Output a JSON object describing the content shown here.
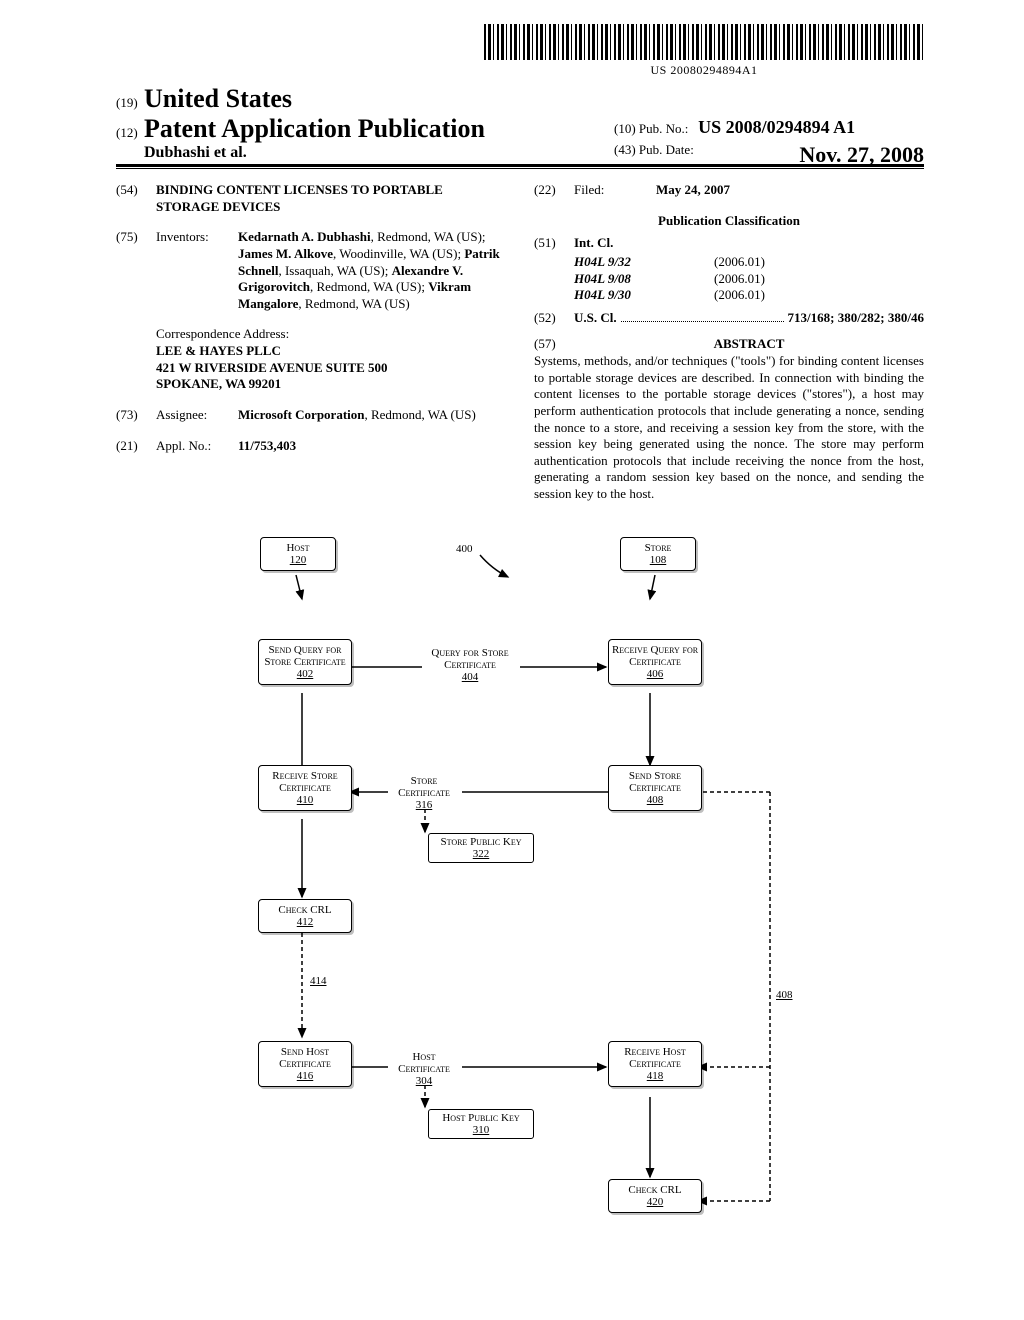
{
  "barcode_number": "US 20080294894A1",
  "header": {
    "num19": "(19)",
    "country": "United States",
    "num12": "(12)",
    "type": "Patent Application Publication",
    "authors_short": "Dubhashi et al.",
    "num10": "(10)",
    "pubno_label": "Pub. No.:",
    "pubno": "US 2008/0294894 A1",
    "num43": "(43)",
    "pubdate_label": "Pub. Date:",
    "pubdate": "Nov. 27, 2008"
  },
  "left": {
    "f54_num": "(54)",
    "f54_title": "BINDING CONTENT LICENSES TO PORTABLE STORAGE DEVICES",
    "f75_num": "(75)",
    "f75_label": "Inventors:",
    "inventors_html": "<b>Kedarnath A. Dubhashi</b>, Redmond, WA (US); <b>James M. Alkove</b>, Woodinville, WA (US); <b>Patrik Schnell</b>, Issaquah, WA (US); <b>Alexandre V. Grigorovitch</b>, Redmond, WA (US); <b>Vikram Mangalore</b>, Redmond, WA (US)",
    "corr_l1": "Correspondence Address:",
    "corr_l2": "LEE & HAYES PLLC",
    "corr_l3": "421 W RIVERSIDE AVENUE SUITE 500",
    "corr_l4": "SPOKANE, WA 99201",
    "f73_num": "(73)",
    "f73_label": "Assignee:",
    "f73_val_html": "<b>Microsoft Corporation</b>, Redmond, WA (US)",
    "f21_num": "(21)",
    "f21_label": "Appl. No.:",
    "f21_val": "11/753,403"
  },
  "right": {
    "f22_num": "(22)",
    "f22_label": "Filed:",
    "f22_val": "May 24, 2007",
    "pubclass": "Publication Classification",
    "f51_num": "(51)",
    "f51_label": "Int. Cl.",
    "intcl": [
      {
        "code": "H04L 9/32",
        "ver": "(2006.01)"
      },
      {
        "code": "H04L 9/08",
        "ver": "(2006.01)"
      },
      {
        "code": "H04L 9/30",
        "ver": "(2006.01)"
      }
    ],
    "f52_num": "(52)",
    "f52_label": "U.S. Cl.",
    "f52_val": "713/168; 380/282; 380/46",
    "f57_num": "(57)",
    "abstract_h": "ABSTRACT",
    "abstract_txt": "Systems, methods, and/or techniques (\"tools\") for binding content licenses to portable storage devices are described. In connection with binding the content licenses to the portable storage devices (\"stores\"), a host may perform authentication protocols that include generating a nonce, sending the nonce to a store, and receiving a session key from the store, with the session key being generated using the nonce. The store may perform authentication protocols that include receiving the nonce from the host, generating a random session key based on the nonce, and sending the session key to the host."
  },
  "figure": {
    "host": "Host",
    "host_n": "120",
    "store": "Store",
    "store_n": "108",
    "ref400": "400",
    "b402": "Send Query for Store Certificate",
    "b402_n": "402",
    "l404": "Query for Store Certificate",
    "l404_n": "404",
    "b406": "Receive Query for Certificate",
    "b406_n": "406",
    "b408": "Send Store Certificate",
    "b408_n": "408",
    "l316": "Store Certificate",
    "l316_n": "316",
    "b410": "Receive Store Certificate",
    "b410_n": "410",
    "l322": "Store Public Key",
    "l322_n": "322",
    "b412": "Check CRL",
    "b412_n": "412",
    "l414": "414",
    "b416": "Send Host Certificate",
    "b416_n": "416",
    "l304": "Host Certificate",
    "l304_n": "304",
    "b418": "Receive Host Certificate",
    "b418_n": "418",
    "l310": "Host Public Key",
    "l310_n": "310",
    "b420": "Check CRL",
    "b420_n": "420",
    "ref408r": "408"
  }
}
